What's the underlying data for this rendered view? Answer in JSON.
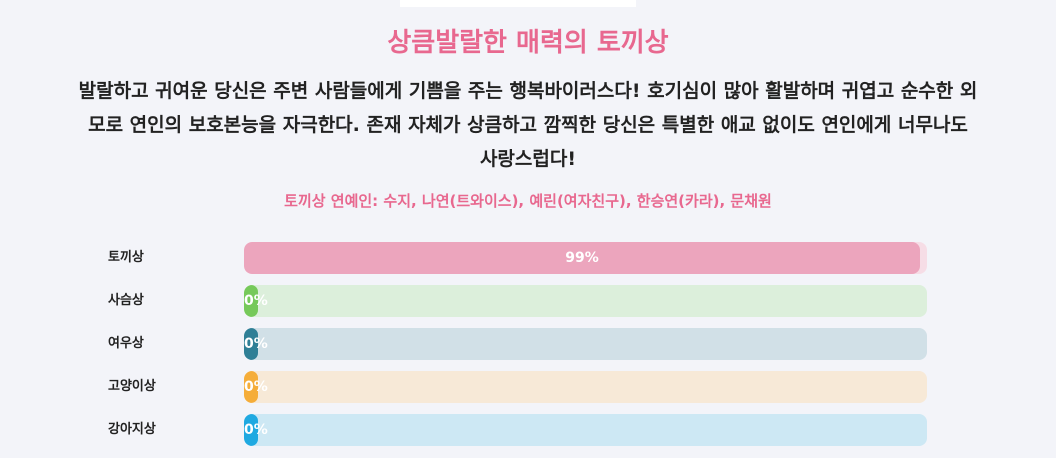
{
  "result": {
    "title": "상큼발랄한 매력의 토끼상",
    "description_lines": [
      "발랄하고 귀여운 당신은 주변 사람들에게 기쁨을 주는 행복바이러스다! 호기심이 많아 활발하며 귀엽고 순수한 외",
      "모로 연인의 보호본능을 자극한다. 존재 자체가 상큼하고 깜찍한 당신은 특별한 애교 없이도 연인에게 너무나도",
      "사랑스럽다!"
    ],
    "celebrities": "토끼상 연예인: 수지, 나연(트와이스), 예린(여자친구), 한승연(카라), 문채원"
  },
  "bars": [
    {
      "label": "토끼상",
      "percent": 99,
      "percent_text": "99%",
      "fill_color": "#eca5bd",
      "track_color": "#f6dde6"
    },
    {
      "label": "사슴상",
      "percent": 0,
      "percent_text": "0%",
      "fill_color": "#76c95a",
      "track_color": "#dcefdb"
    },
    {
      "label": "여우상",
      "percent": 0,
      "percent_text": "0%",
      "fill_color": "#2f7f96",
      "track_color": "#d1e0e7"
    },
    {
      "label": "고양이상",
      "percent": 0,
      "percent_text": "0%",
      "fill_color": "#f5ad39",
      "track_color": "#f7e9d7"
    },
    {
      "label": "강아지상",
      "percent": 0,
      "percent_text": "0%",
      "fill_color": "#1fa9e1",
      "track_color": "#cde8f4"
    }
  ],
  "colors": {
    "accent": "#e8688f",
    "background": "#f3f4f9",
    "text": "#222222"
  }
}
